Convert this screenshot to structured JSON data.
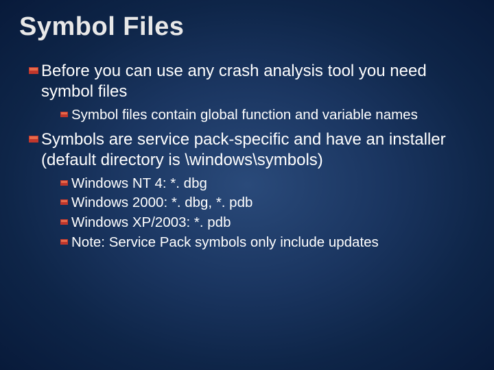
{
  "title": "Symbol Files",
  "bullets": [
    {
      "text": "Before you can use any crash analysis tool you need symbol files",
      "children": [
        {
          "text": "Symbol files contain global function and variable names"
        }
      ]
    },
    {
      "text": "Symbols are service pack-specific and have an installer (default directory is \\windows\\symbols)",
      "children": [
        {
          "text": "Windows NT 4: *. dbg"
        },
        {
          "text": "Windows 2000: *. dbg, *. pdb"
        },
        {
          "text": "Windows XP/2003: *. pdb"
        },
        {
          "text": "Note: Service Pack symbols only include updates"
        }
      ]
    }
  ]
}
